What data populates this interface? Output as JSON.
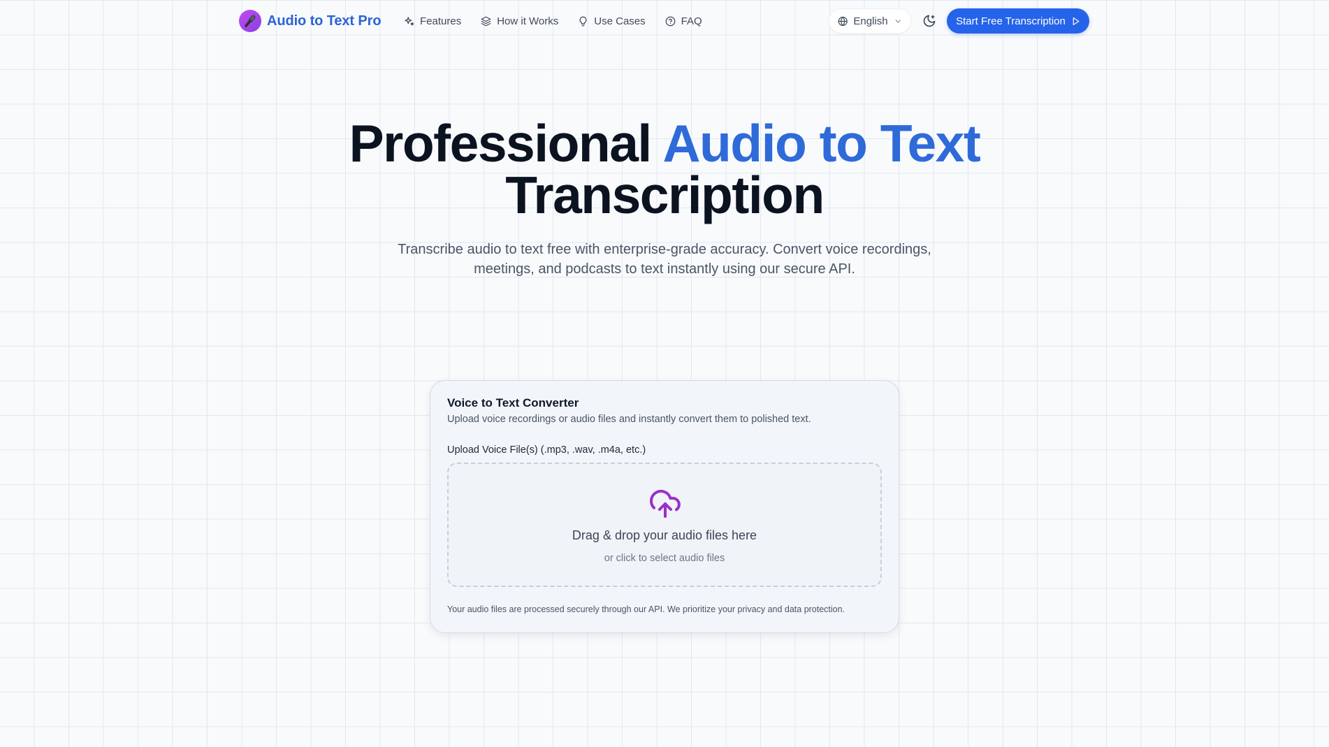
{
  "brand": {
    "name": "Audio to Text Pro",
    "logo_icon": "microphone-icon",
    "logo_gradient": [
      "#c04cf0",
      "#8b3fe0"
    ]
  },
  "nav": {
    "links": [
      {
        "label": "Features",
        "icon": "sparkles-icon"
      },
      {
        "label": "How it Works",
        "icon": "layers-icon"
      },
      {
        "label": "Use Cases",
        "icon": "lightbulb-icon"
      },
      {
        "label": "FAQ",
        "icon": "help-circle-icon"
      }
    ],
    "language": {
      "selected": "English",
      "icon": "globe-icon"
    },
    "theme_toggle_icon": "moon-icon",
    "cta": {
      "label": "Start Free Transcription",
      "icon": "play-icon"
    }
  },
  "hero": {
    "title_part1": "Professional ",
    "title_accent": "Audio to Text",
    "title_part2": " Transcription",
    "subtitle": "Transcribe audio to text free with enterprise-grade accuracy. Convert voice recordings, meetings, and podcasts to text instantly using our secure API."
  },
  "converter": {
    "title": "Voice to Text Converter",
    "description": "Upload voice recordings or audio files and instantly convert them to polished text.",
    "upload_label": "Upload Voice File(s) (.mp3, .wav, .m4a, etc.)",
    "dropzone": {
      "icon": "cloud-upload-icon",
      "main_text": "Drag & drop your audio files here",
      "sub_text": "or click to select audio files"
    },
    "privacy_note": "Your audio files are processed securely through our API. We prioritize your privacy and data protection."
  },
  "colors": {
    "primary": "#2563eb",
    "accent_text": "#2f6ad9",
    "upload_icon": "#9b2fc8",
    "background": "#f8fafc"
  }
}
